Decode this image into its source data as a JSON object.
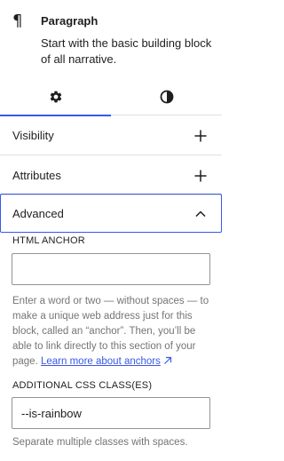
{
  "block": {
    "icon": "pilcrow-icon",
    "title": "Paragraph",
    "description": "Start with the basic building block of all narrative."
  },
  "tabs": [
    {
      "name": "settings",
      "icon": "gear-icon",
      "active": true
    },
    {
      "name": "styles",
      "icon": "contrast-icon",
      "active": false
    }
  ],
  "panels": {
    "visibility": {
      "label": "Visibility",
      "icon": "plus-icon"
    },
    "attributes": {
      "label": "Attributes",
      "icon": "plus-icon"
    },
    "advanced": {
      "label": "Advanced",
      "icon": "chevron-up-icon",
      "expanded": true
    }
  },
  "advanced": {
    "html_anchor": {
      "label": "HTML ANCHOR",
      "value": "",
      "help": "Enter a word or two — without spaces — to make a unique web address just for this block, called an “anchor”. Then, you’ll be able to link directly to this section of your page.",
      "link": "Learn more about anchors"
    },
    "css_class": {
      "label": "ADDITIONAL CSS CLASS(ES)",
      "value": "--is-rainbow",
      "help": "Separate multiple classes with spaces."
    }
  },
  "colors": {
    "accent": "#3858e9",
    "text": "#1e1e1e",
    "muted": "#757575",
    "border": "#e0e0e0"
  }
}
